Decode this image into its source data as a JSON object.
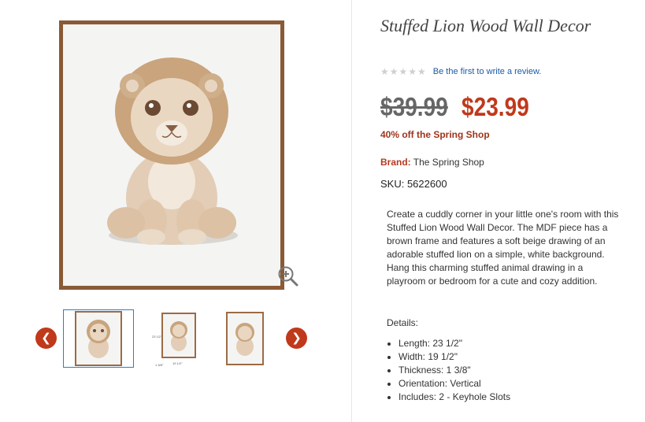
{
  "product": {
    "title": "Stuffed Lion Wood Wall Decor",
    "rating": {
      "stars": 0,
      "max": 5,
      "review_link": "Be the first to write a review."
    },
    "price": {
      "original": "$39.99",
      "sale": "$23.99"
    },
    "promo": "40% off the Spring Shop",
    "brand": {
      "label": "Brand:",
      "value": "The Spring Shop"
    },
    "sku": "SKU: 5622600",
    "description": "Create a cuddly corner in your little one's room with this Stuffed Lion Wood Wall Decor. The MDF piece has a brown frame and features a soft beige drawing of an adorable stuffed lion on a simple, white background. Hang this charming stuffed animal drawing in a playroom or bedroom for a cute and cozy addition.",
    "details_label": "Details:",
    "details": [
      "Length: 23 1/2\"",
      "Width: 19 1/2\"",
      "Thickness: 1 3/8\"",
      "Orientation: Vertical",
      "Includes: 2 - Keyhole Slots"
    ]
  },
  "gallery": {
    "zoom_icon": "zoom-in-icon",
    "prev_icon": "chevron-left-icon",
    "next_icon": "chevron-right-icon",
    "thumbnail_dimensions": {
      "height": "23 1/2\"",
      "width": "19 1/2\"",
      "depth": "1 3/8\""
    }
  },
  "colors": {
    "sale_price": "#c0391b",
    "link": "#1a5aa6",
    "frame": "#8a5a35",
    "selected_thumb_border": "#2a7fc1"
  }
}
